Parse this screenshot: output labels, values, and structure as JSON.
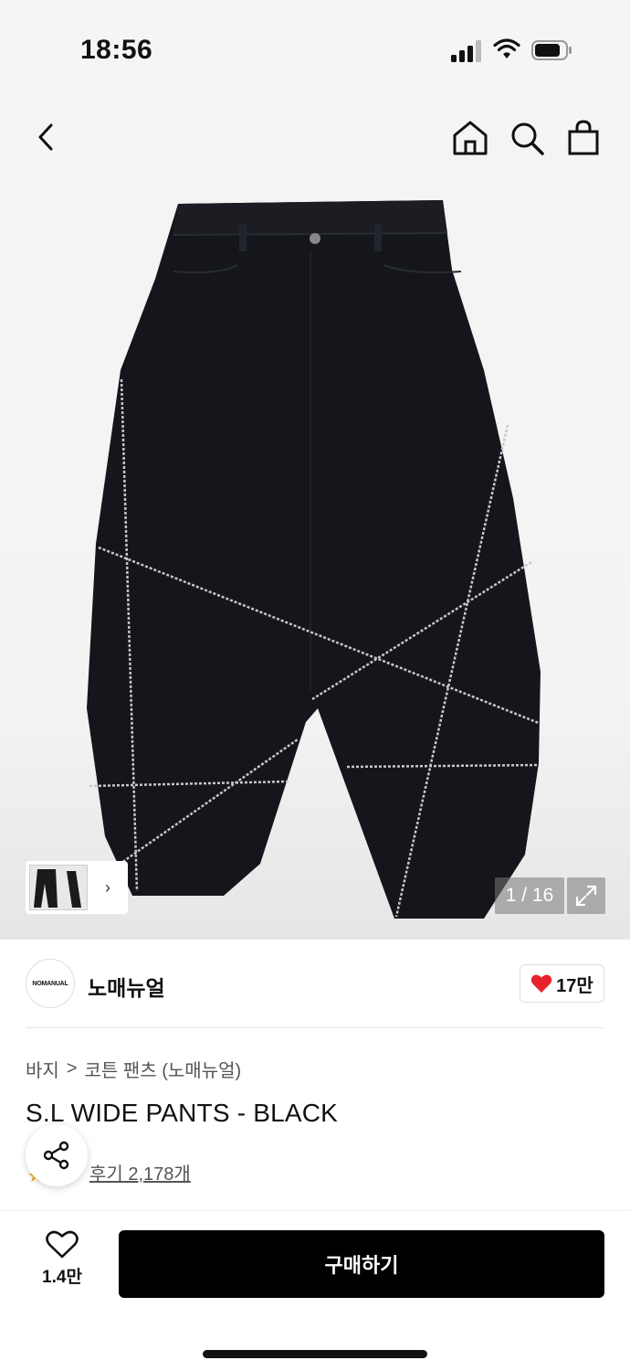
{
  "status": {
    "time": "18:56"
  },
  "icons": {
    "back": "chevron-left-icon",
    "home": "home-icon",
    "search": "search-icon",
    "bag": "shopping-bag-icon",
    "zoom": "expand-icon",
    "heart": "heart-icon",
    "share": "share-icon",
    "star": "star-icon"
  },
  "gallery": {
    "current": "1",
    "separator": " / ",
    "total": "16",
    "counter_text": "1 / 16"
  },
  "brand": {
    "logo_text": "NOMANUAL",
    "name": "노매뉴얼",
    "likes": "17만"
  },
  "breadcrumb": {
    "category": "바지",
    "separator": ">",
    "subcategory": "코튼 팬츠 (노매뉴얼)"
  },
  "product": {
    "title": "S.L WIDE PANTS - BLACK"
  },
  "reviews": {
    "label": "후기 2,178개"
  },
  "bottom_bar": {
    "wish_count": "1.4만",
    "buy_label": "구매하기"
  },
  "colors": {
    "accent": "#000000",
    "heart": "#e8222a",
    "star": "#f5a623"
  }
}
